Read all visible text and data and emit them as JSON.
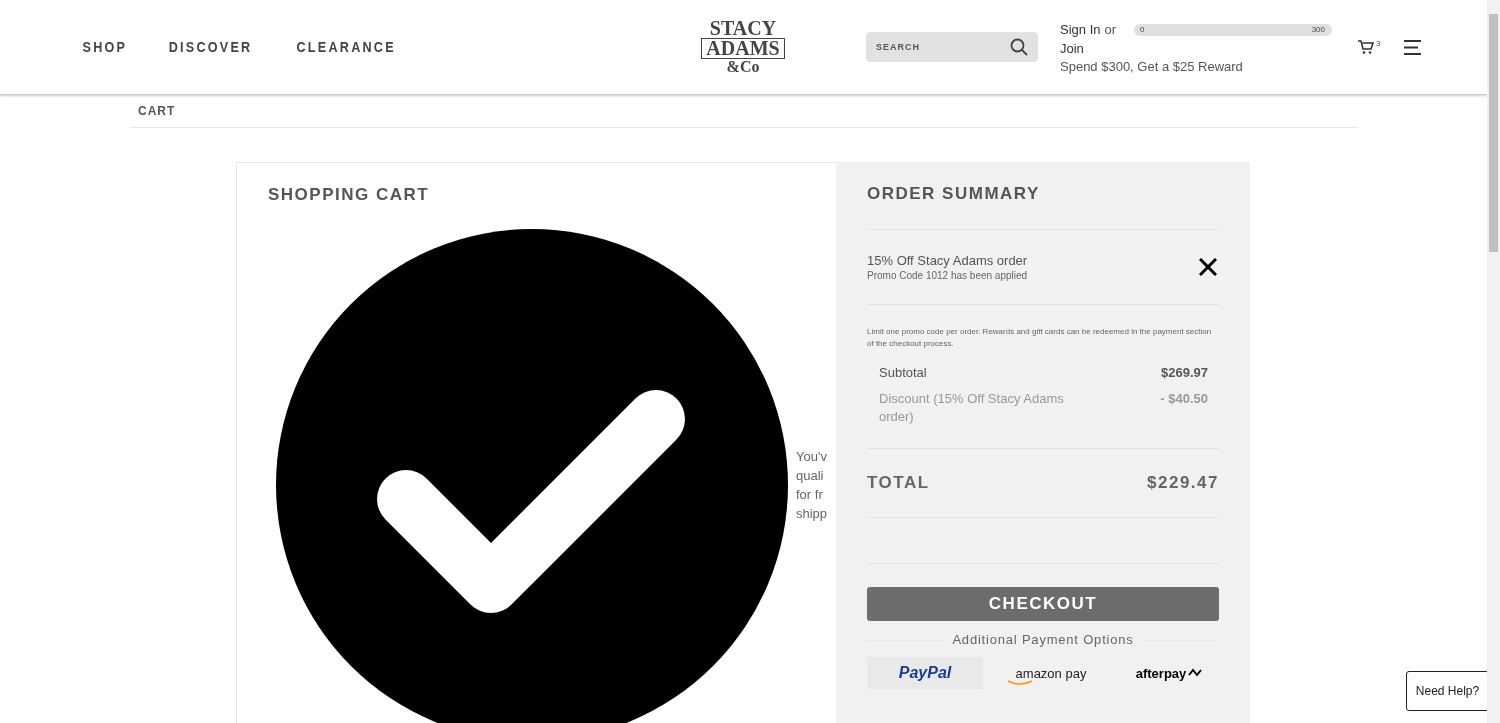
{
  "nav": [
    {
      "label": "SHOP"
    },
    {
      "label": "DISCOVER"
    },
    {
      "label": "CLEARANCE"
    }
  ],
  "logo": {
    "lines": [
      "STACY",
      "ADAMS",
      "&Co"
    ]
  },
  "search": {
    "placeholder": "SEARCH"
  },
  "account": {
    "sign_in": "Sign In",
    "or": "or",
    "join": "Join",
    "reward_text": "Spend $300, Get a $25 Reward",
    "progress": {
      "min": "0",
      "max": "300",
      "level": 0
    }
  },
  "cart": {
    "count": "3"
  },
  "breadcrumb": "CART",
  "shopping_cart": {
    "title": "SHOPPING CART",
    "message_lines": [
      "You'v",
      "quali",
      "for fr",
      "shipp"
    ]
  },
  "order_summary": {
    "title": "ORDER SUMMARY",
    "promo": {
      "name": "15% Off Stacy Adams order",
      "note": "Promo Code 1012 has been applied"
    },
    "limit_note": "Limit one promo code per order. Rewards and gift cards can be redeemed in the payment section of the checkout process.",
    "lines": [
      {
        "label": "Subtotal",
        "value": "$269.97",
        "kind": "normal"
      },
      {
        "label": "Discount (15% Off Stacy Adams order)",
        "value": "- $40.50",
        "kind": "discount"
      }
    ],
    "total": {
      "label": "TOTAL",
      "value": "$229.47"
    },
    "checkout": "CHECKOUT",
    "additional": "Additional Payment Options",
    "payments": [
      {
        "label": "PayPal",
        "kind": "paypal"
      },
      {
        "label": "amazon pay",
        "kind": "amazon"
      },
      {
        "label": "afterpay",
        "kind": "afterpay"
      }
    ]
  },
  "help": "Need Help?"
}
